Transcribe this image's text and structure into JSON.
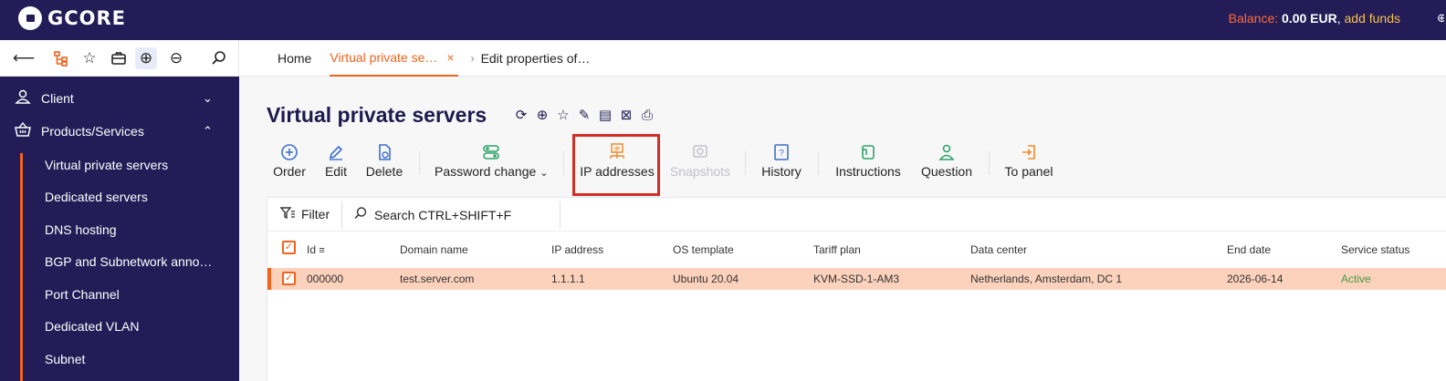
{
  "app": {
    "logo_text": "GCORE"
  },
  "header": {
    "balance_label": "Balance:",
    "balance_value": "0.00 EUR",
    "separator": ",",
    "add_funds": "add funds"
  },
  "nav_icons": [
    "back-arrow-icon",
    "tree-icon",
    "star-icon",
    "briefcase-icon",
    "zoom-in-icon",
    "zoom-out-icon",
    "search-icon"
  ],
  "breadcrumb": {
    "home": "Home",
    "active_tab": "Virtual private se…",
    "close": "×",
    "last": "Edit properties of…"
  },
  "sidebar": {
    "sections": [
      {
        "label": "Client",
        "icon": "user-icon",
        "expanded": false
      },
      {
        "label": "Products/Services",
        "icon": "basket-icon",
        "expanded": true
      }
    ],
    "items": [
      "Virtual private servers",
      "Dedicated servers",
      "DNS hosting",
      "BGP and Subnetwork anno…",
      "Port Channel",
      "Dedicated VLAN",
      "Subnet"
    ]
  },
  "main": {
    "title": "Virtual private servers",
    "title_icons": [
      "refresh-icon",
      "globe-icon",
      "star-icon",
      "pin-icon",
      "list-doc-icon",
      "excel-icon",
      "print-icon"
    ],
    "actions": [
      {
        "label": "Order",
        "icon": "plus-circle-icon",
        "enabled": true
      },
      {
        "label": "Edit",
        "icon": "pencil-icon",
        "enabled": true
      },
      {
        "label": "Delete",
        "icon": "delete-doc-icon",
        "enabled": true
      },
      {
        "label": "Password change",
        "icon": "toggles-icon",
        "enabled": true,
        "dropdown": true
      },
      {
        "label": "IP addresses",
        "icon": "ip-network-icon",
        "enabled": true,
        "highlighted": true
      },
      {
        "label": "Snapshots",
        "icon": "snapshot-icon",
        "enabled": false
      },
      {
        "label": "History",
        "icon": "question-doc-icon",
        "enabled": true
      },
      {
        "label": "Instructions",
        "icon": "instructions-icon",
        "enabled": true
      },
      {
        "label": "Question",
        "icon": "user-question-icon",
        "enabled": true
      },
      {
        "label": "To panel",
        "icon": "enter-panel-icon",
        "enabled": true
      }
    ]
  },
  "grid": {
    "filter_label": "Filter",
    "search_label": "Search CTRL+SHIFT+F",
    "columns": [
      "Id",
      "Domain name",
      "IP address",
      "OS template",
      "Tariff plan",
      "Data center",
      "End date",
      "Service status"
    ],
    "rows": [
      {
        "id": "000000",
        "domain": "test.server.com",
        "ip": "1.1.1.1",
        "os": "Ubuntu 20.04",
        "tariff": "KVM-SSD-1-AM3",
        "datacenter": "Netherlands, Amsterdam, DC 1",
        "end_date": "2026-06-14",
        "status": "Active",
        "selected": true
      }
    ]
  },
  "colors": {
    "header_bg": "#231c57",
    "accent": "#f0641e",
    "selected_row": "#fcd2bd",
    "status_active": "#3f9a3f",
    "highlight_box": "#d42d25"
  }
}
